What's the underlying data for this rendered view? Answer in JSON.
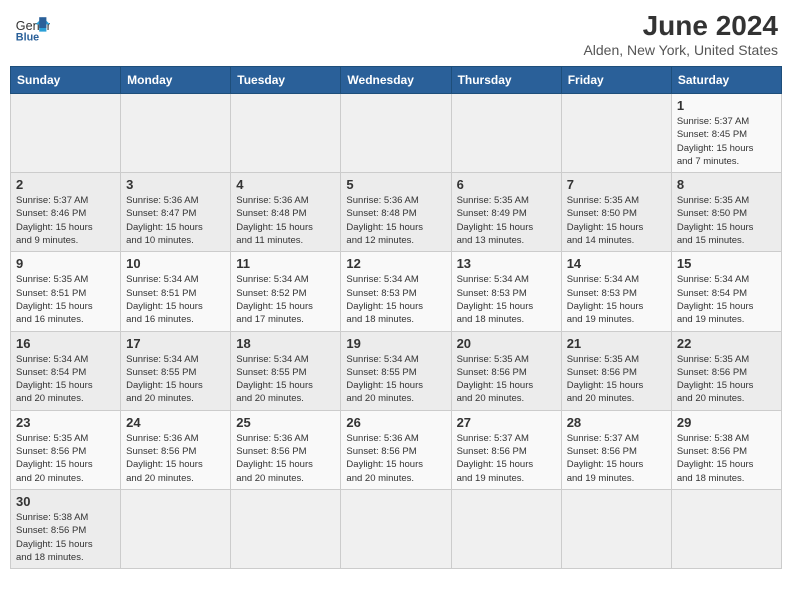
{
  "header": {
    "logo_text_regular": "General",
    "logo_text_bold": "Blue",
    "title": "June 2024",
    "subtitle": "Alden, New York, United States"
  },
  "weekdays": [
    "Sunday",
    "Monday",
    "Tuesday",
    "Wednesday",
    "Thursday",
    "Friday",
    "Saturday"
  ],
  "weeks": [
    [
      {
        "day": "",
        "info": ""
      },
      {
        "day": "",
        "info": ""
      },
      {
        "day": "",
        "info": ""
      },
      {
        "day": "",
        "info": ""
      },
      {
        "day": "",
        "info": ""
      },
      {
        "day": "",
        "info": ""
      },
      {
        "day": "1",
        "info": "Sunrise: 5:37 AM\nSunset: 8:45 PM\nDaylight: 15 hours\nand 7 minutes."
      }
    ],
    [
      {
        "day": "2",
        "info": "Sunrise: 5:37 AM\nSunset: 8:46 PM\nDaylight: 15 hours\nand 9 minutes."
      },
      {
        "day": "3",
        "info": "Sunrise: 5:36 AM\nSunset: 8:47 PM\nDaylight: 15 hours\nand 10 minutes."
      },
      {
        "day": "4",
        "info": "Sunrise: 5:36 AM\nSunset: 8:48 PM\nDaylight: 15 hours\nand 11 minutes."
      },
      {
        "day": "5",
        "info": "Sunrise: 5:36 AM\nSunset: 8:48 PM\nDaylight: 15 hours\nand 12 minutes."
      },
      {
        "day": "6",
        "info": "Sunrise: 5:35 AM\nSunset: 8:49 PM\nDaylight: 15 hours\nand 13 minutes."
      },
      {
        "day": "7",
        "info": "Sunrise: 5:35 AM\nSunset: 8:50 PM\nDaylight: 15 hours\nand 14 minutes."
      },
      {
        "day": "8",
        "info": "Sunrise: 5:35 AM\nSunset: 8:50 PM\nDaylight: 15 hours\nand 15 minutes."
      }
    ],
    [
      {
        "day": "9",
        "info": "Sunrise: 5:35 AM\nSunset: 8:51 PM\nDaylight: 15 hours\nand 16 minutes."
      },
      {
        "day": "10",
        "info": "Sunrise: 5:34 AM\nSunset: 8:51 PM\nDaylight: 15 hours\nand 16 minutes."
      },
      {
        "day": "11",
        "info": "Sunrise: 5:34 AM\nSunset: 8:52 PM\nDaylight: 15 hours\nand 17 minutes."
      },
      {
        "day": "12",
        "info": "Sunrise: 5:34 AM\nSunset: 8:53 PM\nDaylight: 15 hours\nand 18 minutes."
      },
      {
        "day": "13",
        "info": "Sunrise: 5:34 AM\nSunset: 8:53 PM\nDaylight: 15 hours\nand 18 minutes."
      },
      {
        "day": "14",
        "info": "Sunrise: 5:34 AM\nSunset: 8:53 PM\nDaylight: 15 hours\nand 19 minutes."
      },
      {
        "day": "15",
        "info": "Sunrise: 5:34 AM\nSunset: 8:54 PM\nDaylight: 15 hours\nand 19 minutes."
      }
    ],
    [
      {
        "day": "16",
        "info": "Sunrise: 5:34 AM\nSunset: 8:54 PM\nDaylight: 15 hours\nand 20 minutes."
      },
      {
        "day": "17",
        "info": "Sunrise: 5:34 AM\nSunset: 8:55 PM\nDaylight: 15 hours\nand 20 minutes."
      },
      {
        "day": "18",
        "info": "Sunrise: 5:34 AM\nSunset: 8:55 PM\nDaylight: 15 hours\nand 20 minutes."
      },
      {
        "day": "19",
        "info": "Sunrise: 5:34 AM\nSunset: 8:55 PM\nDaylight: 15 hours\nand 20 minutes."
      },
      {
        "day": "20",
        "info": "Sunrise: 5:35 AM\nSunset: 8:56 PM\nDaylight: 15 hours\nand 20 minutes."
      },
      {
        "day": "21",
        "info": "Sunrise: 5:35 AM\nSunset: 8:56 PM\nDaylight: 15 hours\nand 20 minutes."
      },
      {
        "day": "22",
        "info": "Sunrise: 5:35 AM\nSunset: 8:56 PM\nDaylight: 15 hours\nand 20 minutes."
      }
    ],
    [
      {
        "day": "23",
        "info": "Sunrise: 5:35 AM\nSunset: 8:56 PM\nDaylight: 15 hours\nand 20 minutes."
      },
      {
        "day": "24",
        "info": "Sunrise: 5:36 AM\nSunset: 8:56 PM\nDaylight: 15 hours\nand 20 minutes."
      },
      {
        "day": "25",
        "info": "Sunrise: 5:36 AM\nSunset: 8:56 PM\nDaylight: 15 hours\nand 20 minutes."
      },
      {
        "day": "26",
        "info": "Sunrise: 5:36 AM\nSunset: 8:56 PM\nDaylight: 15 hours\nand 20 minutes."
      },
      {
        "day": "27",
        "info": "Sunrise: 5:37 AM\nSunset: 8:56 PM\nDaylight: 15 hours\nand 19 minutes."
      },
      {
        "day": "28",
        "info": "Sunrise: 5:37 AM\nSunset: 8:56 PM\nDaylight: 15 hours\nand 19 minutes."
      },
      {
        "day": "29",
        "info": "Sunrise: 5:38 AM\nSunset: 8:56 PM\nDaylight: 15 hours\nand 18 minutes."
      }
    ],
    [
      {
        "day": "30",
        "info": "Sunrise: 5:38 AM\nSunset: 8:56 PM\nDaylight: 15 hours\nand 18 minutes."
      },
      {
        "day": "",
        "info": ""
      },
      {
        "day": "",
        "info": ""
      },
      {
        "day": "",
        "info": ""
      },
      {
        "day": "",
        "info": ""
      },
      {
        "day": "",
        "info": ""
      },
      {
        "day": "",
        "info": ""
      }
    ]
  ]
}
